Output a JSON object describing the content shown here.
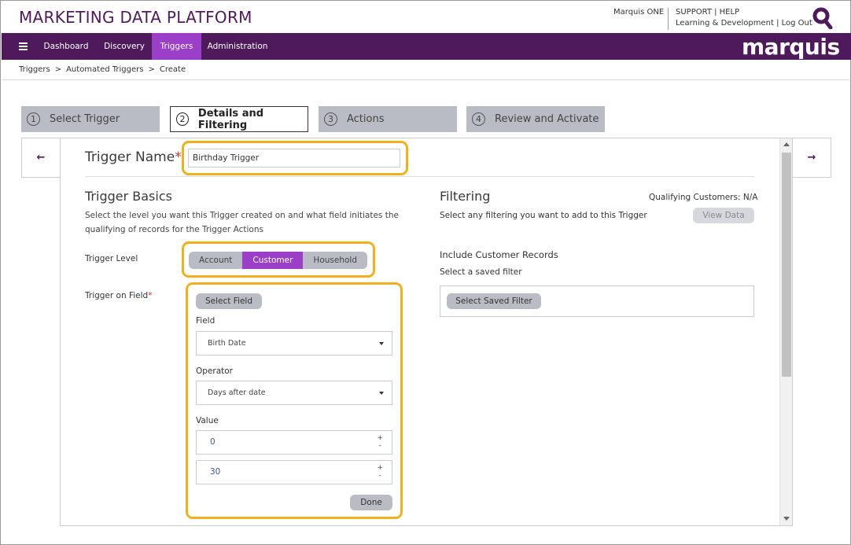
{
  "header": {
    "app_title": "MARKETING DATA PLATFORM",
    "marquis_one": "Marquis ONE",
    "support": "SUPPORT | HELP",
    "learning": "Learning & Development | Log Out",
    "brand": "marquis"
  },
  "nav": {
    "items": [
      {
        "label": "Dashboard"
      },
      {
        "label": "Discovery"
      },
      {
        "label": "Triggers"
      },
      {
        "label": "Administration"
      }
    ]
  },
  "breadcrumb": {
    "items": [
      "Triggers",
      "Automated Triggers",
      "Create"
    ],
    "separator": ">"
  },
  "steps": [
    {
      "num": "1",
      "label": "Select Trigger"
    },
    {
      "num": "2",
      "label": "Details and Filtering"
    },
    {
      "num": "3",
      "label": "Actions"
    },
    {
      "num": "4",
      "label": "Review and Activate"
    }
  ],
  "form": {
    "trigger_name_label": "Trigger Name",
    "required_mark": "*",
    "trigger_name_value": "Birthday Trigger",
    "basics_title": "Trigger Basics",
    "basics_desc": "Select the level you want this Trigger created on and what field initiates the qualifying of records for the Trigger Actions",
    "level_label": "Trigger Level",
    "level_options": [
      "Account",
      "Customer",
      "Household"
    ],
    "field_label": "Trigger on Field",
    "select_field_btn": "Select Field",
    "field_sub_label": "Field",
    "field_value": "Birth Date",
    "operator_label": "Operator",
    "operator_value": "Days after date",
    "value_label": "Value",
    "value_1": "0",
    "value_2": "30",
    "spin_plus": "+",
    "spin_minus": "-",
    "done_btn": "Done"
  },
  "filtering": {
    "title": "Filtering",
    "qualifying": "Qualifying Customers: N/A",
    "desc": "Select any filtering you want to add to this Trigger",
    "view_data_btn": "View Data",
    "include_label": "Include Customer Records",
    "saved_filter_label": "Select a saved filter",
    "saved_filter_btn": "Select Saved Filter"
  },
  "colors": {
    "brand_purple": "#4e1a5c",
    "active_purple": "#9b3fc9",
    "highlight": "#f2b01e"
  }
}
